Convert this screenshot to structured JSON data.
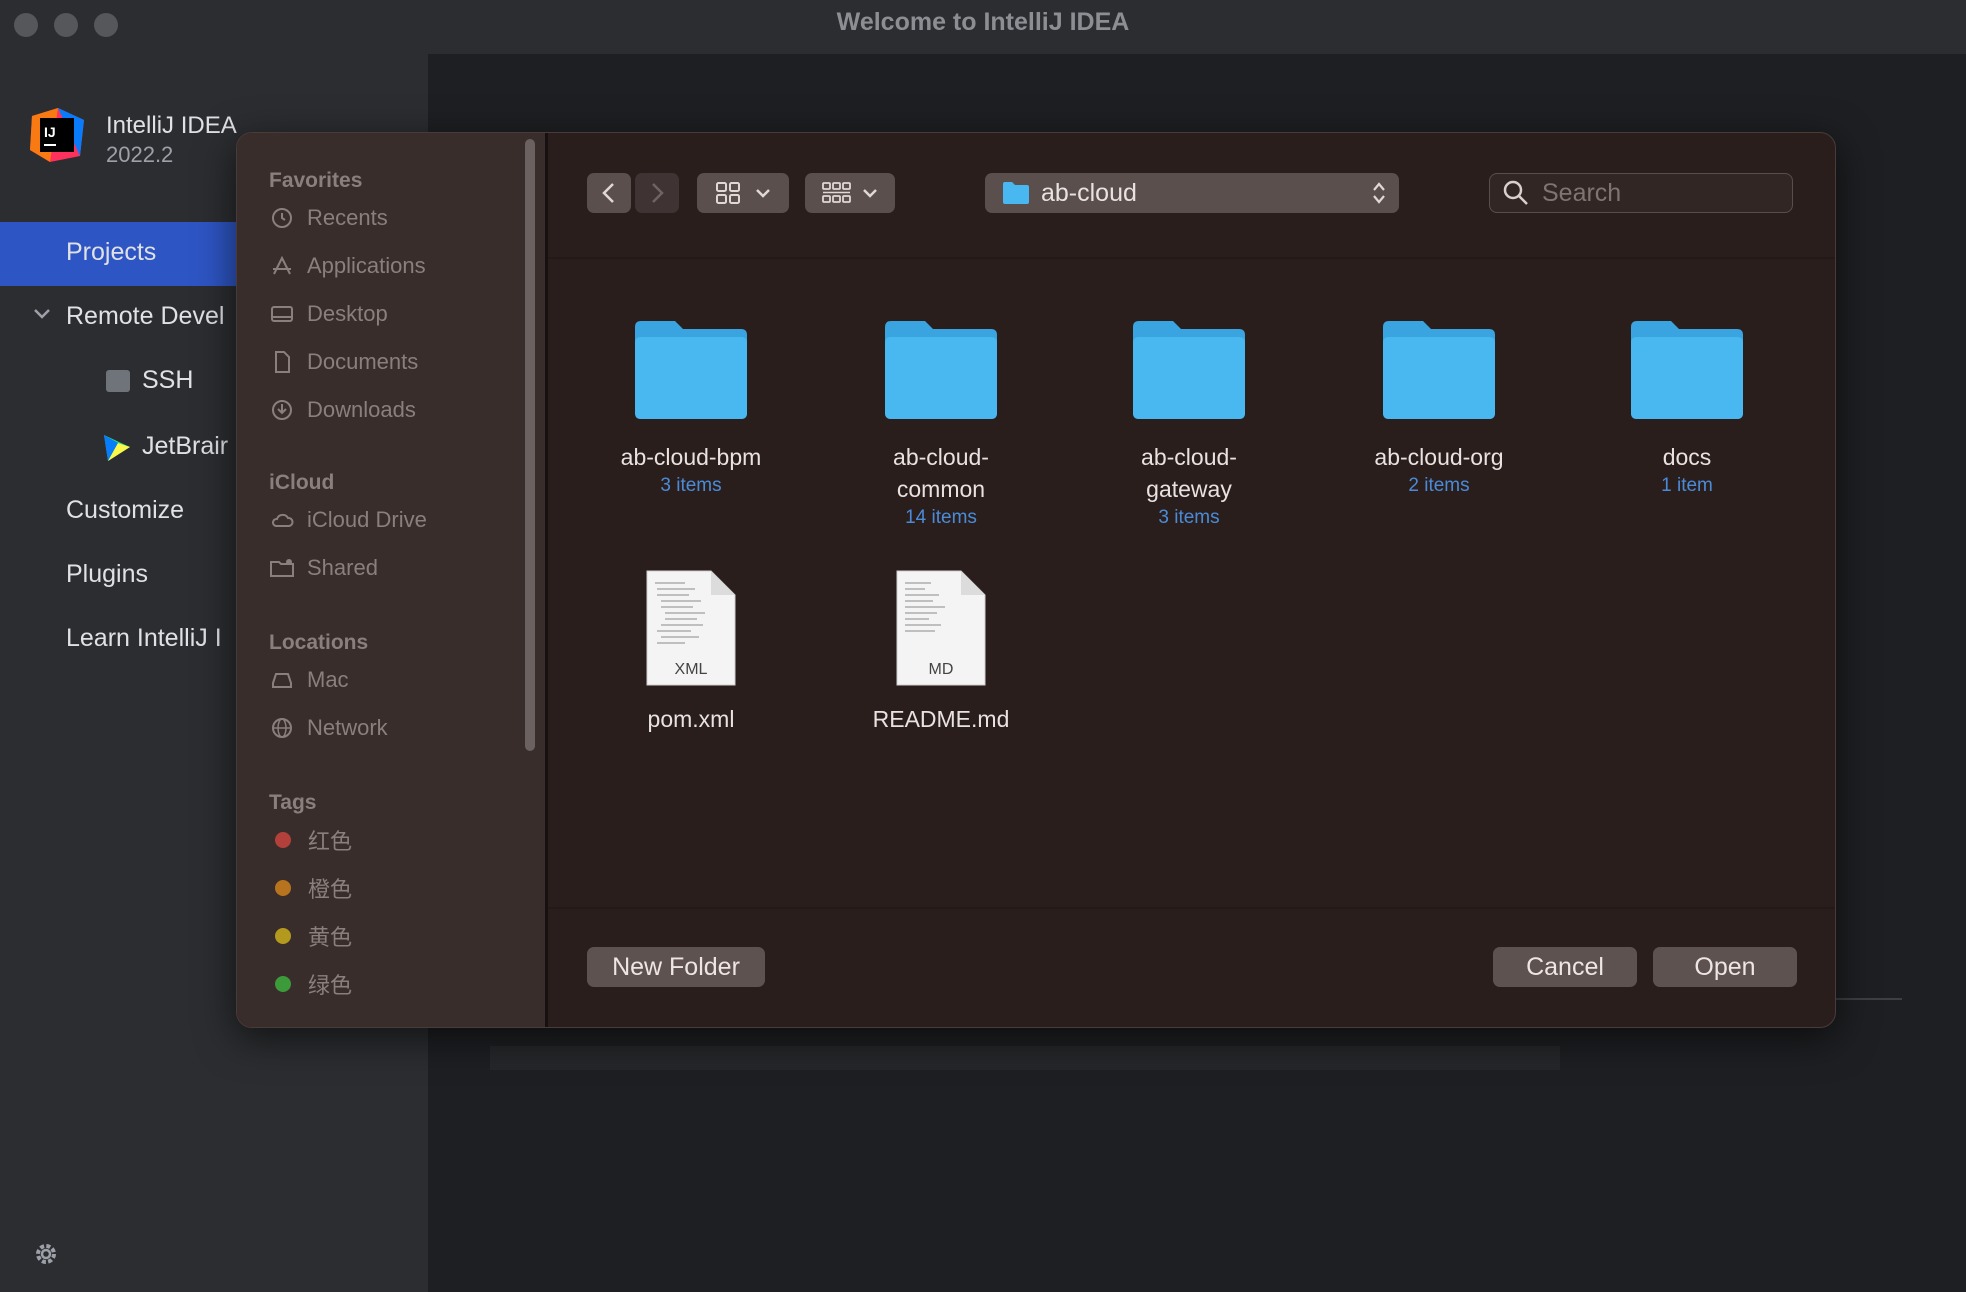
{
  "window": {
    "title": "Welcome to IntelliJ IDEA"
  },
  "welcome": {
    "app_name": "IntelliJ IDEA",
    "app_version": "2022.2",
    "nav": {
      "projects": "Projects",
      "remote_dev": "Remote Devel",
      "ssh": "SSH",
      "jetbrains": "JetBrair",
      "customize": "Customize",
      "plugins": "Plugins",
      "learn": "Learn IntelliJ I"
    }
  },
  "dialog": {
    "sidebar": {
      "favorites_header": "Favorites",
      "favorites": [
        "Recents",
        "Applications",
        "Desktop",
        "Documents",
        "Downloads"
      ],
      "icloud_header": "iCloud",
      "icloud": [
        "iCloud Drive",
        "Shared"
      ],
      "locations_header": "Locations",
      "locations": [
        "Mac",
        "Network"
      ],
      "tags_header": "Tags",
      "tags": [
        {
          "label": "红色",
          "color": "#b3403a"
        },
        {
          "label": "橙色",
          "color": "#b8731f"
        },
        {
          "label": "黄色",
          "color": "#b39a1e"
        },
        {
          "label": "绿色",
          "color": "#3c9a3a"
        }
      ]
    },
    "toolbar": {
      "current_folder": "ab-cloud",
      "search_placeholder": "Search"
    },
    "items": [
      {
        "name": "ab-cloud-bpm",
        "count": "3 items",
        "kind": "folder"
      },
      {
        "name": "ab-cloud-common",
        "count": "14 items",
        "kind": "folder"
      },
      {
        "name": "ab-cloud-gateway",
        "count": "3 items",
        "kind": "folder"
      },
      {
        "name": "ab-cloud-org",
        "count": "2 items",
        "kind": "folder"
      },
      {
        "name": "docs",
        "count": "1 item",
        "kind": "folder"
      },
      {
        "name": "pom.xml",
        "ext": "XML",
        "kind": "file"
      },
      {
        "name": "README.md",
        "ext": "MD",
        "kind": "file"
      }
    ],
    "item_name_lines": {
      "common_1": "ab-cloud-",
      "common_2": "common",
      "gateway_1": "ab-cloud-",
      "gateway_2": "gateway"
    },
    "buttons": {
      "new_folder": "New Folder",
      "cancel": "Cancel",
      "open": "Open"
    },
    "colors": {
      "folder": "#4ab8f0",
      "accent": "#2e55c4",
      "count": "#4a8bd8"
    }
  }
}
